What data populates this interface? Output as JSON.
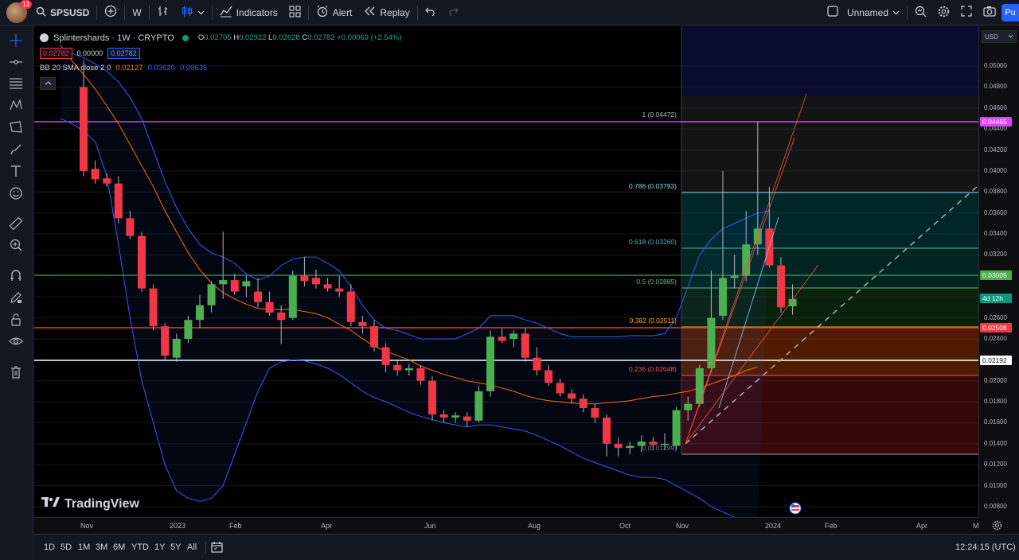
{
  "topbar": {
    "notifications": "13",
    "symbol": "SPSUSD",
    "interval": "W",
    "indicators": "Indicators",
    "alert": "Alert",
    "replay": "Replay",
    "layout_name": "Unnamed",
    "publish": "Pu"
  },
  "legend": {
    "title": "Splintershards · 1W · CRYPTO",
    "o_label": "O",
    "o": "0.02705",
    "h_label": "H",
    "h": "0.02922",
    "l_label": "L",
    "l": "0.02628",
    "c_label": "C",
    "c": "0.02782",
    "change": "+0.00069 (+2.54%)",
    "bid": "0.02782",
    "spread": "0.00000",
    "ask": "0.02782",
    "bb_name": "BB 20 SMA close 2 0",
    "bb_basis": "0.02127",
    "bb_upper": "0.03620",
    "bb_lower": "0.00635"
  },
  "fib": {
    "l1": "1 (0.04472)",
    "l0786": "0.786 (0.03793)",
    "l0618": "0.618 (0.03260)",
    "l05": "0.5 (0.02885)",
    "l0382": "0.382 (0.02511)",
    "l0236": "0.236 (0.02048)",
    "l0": "0 (0.01299)"
  },
  "price_axis": {
    "currency": "USD",
    "ticks": [
      "0.05000",
      "0.04800",
      "0.04600",
      "0.04400",
      "0.04200",
      "0.04000",
      "0.03800",
      "0.03600",
      "0.03400",
      "0.03200",
      "0.03000",
      "0.02800",
      "0.02600",
      "0.02400",
      "0.02200",
      "0.02000",
      "0.01800",
      "0.01600",
      "0.01400",
      "0.01200",
      "0.01000",
      "0.00800"
    ],
    "tag_magenta": "0.04465",
    "tag_green": "0.03005",
    "tag_countdown": "4d 12h",
    "tag_red": "0.02508",
    "tag_white": "0.02192",
    "colors": {
      "magenta": "#e040fb",
      "green": "#4caf50",
      "red": "#f23645",
      "white": "#ffffff",
      "countdown": "#089981"
    }
  },
  "time_axis": {
    "labels": [
      "Nov",
      "2023",
      "Feb",
      "Apr",
      "Jun",
      "Aug",
      "Oct",
      "Nov",
      "2024",
      "Feb",
      "Apr",
      "M"
    ]
  },
  "bottombar": {
    "ranges": [
      "1D",
      "5D",
      "1M",
      "3M",
      "6M",
      "YTD",
      "1Y",
      "5Y",
      "All"
    ],
    "clock": "12:24:15 (UTC)"
  },
  "watermark": "TradingView",
  "chart_data": {
    "type": "candlestick",
    "symbol": "SPSUSD",
    "interval": "1W",
    "ylim": [
      0.007,
      0.0515
    ],
    "colors": {
      "up": "#26a69a",
      "down": "#f23645",
      "bb_band": "#2962ff",
      "bb_basis": "#ff6d00"
    },
    "candles": [
      {
        "o": 0.048,
        "h": 0.0505,
        "l": 0.0395,
        "c": 0.04
      },
      {
        "o": 0.0402,
        "h": 0.041,
        "l": 0.0388,
        "c": 0.0392
      },
      {
        "o": 0.0393,
        "h": 0.0398,
        "l": 0.0385,
        "c": 0.0388
      },
      {
        "o": 0.0388,
        "h": 0.0395,
        "l": 0.035,
        "c": 0.0355
      },
      {
        "o": 0.0355,
        "h": 0.0362,
        "l": 0.0335,
        "c": 0.0338
      },
      {
        "o": 0.0338,
        "h": 0.0342,
        "l": 0.0285,
        "c": 0.0288
      },
      {
        "o": 0.0288,
        "h": 0.0292,
        "l": 0.0248,
        "c": 0.0252
      },
      {
        "o": 0.0252,
        "h": 0.0255,
        "l": 0.022,
        "c": 0.0224
      },
      {
        "o": 0.0222,
        "h": 0.0245,
        "l": 0.0218,
        "c": 0.024
      },
      {
        "o": 0.024,
        "h": 0.0262,
        "l": 0.0236,
        "c": 0.0258
      },
      {
        "o": 0.0258,
        "h": 0.0282,
        "l": 0.025,
        "c": 0.0272
      },
      {
        "o": 0.0272,
        "h": 0.0295,
        "l": 0.0265,
        "c": 0.0292
      },
      {
        "o": 0.0292,
        "h": 0.0342,
        "l": 0.0278,
        "c": 0.0296
      },
      {
        "o": 0.0296,
        "h": 0.0302,
        "l": 0.0282,
        "c": 0.0285
      },
      {
        "o": 0.029,
        "h": 0.03,
        "l": 0.028,
        "c": 0.0295
      },
      {
        "o": 0.0285,
        "h": 0.0298,
        "l": 0.027,
        "c": 0.0275
      },
      {
        "o": 0.0275,
        "h": 0.0285,
        "l": 0.0262,
        "c": 0.0265
      },
      {
        "o": 0.0265,
        "h": 0.0272,
        "l": 0.0235,
        "c": 0.0258
      },
      {
        "o": 0.026,
        "h": 0.0305,
        "l": 0.0258,
        "c": 0.03
      },
      {
        "o": 0.03,
        "h": 0.0318,
        "l": 0.029,
        "c": 0.0295
      },
      {
        "o": 0.0298,
        "h": 0.0306,
        "l": 0.0288,
        "c": 0.0292
      },
      {
        "o": 0.0292,
        "h": 0.0298,
        "l": 0.0285,
        "c": 0.0288
      },
      {
        "o": 0.0288,
        "h": 0.03,
        "l": 0.028,
        "c": 0.0285
      },
      {
        "o": 0.0285,
        "h": 0.0292,
        "l": 0.0252,
        "c": 0.0256
      },
      {
        "o": 0.0256,
        "h": 0.0262,
        "l": 0.0245,
        "c": 0.0252
      },
      {
        "o": 0.0252,
        "h": 0.0258,
        "l": 0.0228,
        "c": 0.0232
      },
      {
        "o": 0.0232,
        "h": 0.0236,
        "l": 0.0208,
        "c": 0.0215
      },
      {
        "o": 0.0215,
        "h": 0.022,
        "l": 0.0205,
        "c": 0.021
      },
      {
        "o": 0.021,
        "h": 0.0216,
        "l": 0.0205,
        "c": 0.0212
      },
      {
        "o": 0.0212,
        "h": 0.0215,
        "l": 0.0196,
        "c": 0.02
      },
      {
        "o": 0.02,
        "h": 0.0204,
        "l": 0.0162,
        "c": 0.0168
      },
      {
        "o": 0.0168,
        "h": 0.0172,
        "l": 0.016,
        "c": 0.0165
      },
      {
        "o": 0.0165,
        "h": 0.017,
        "l": 0.016,
        "c": 0.0167
      },
      {
        "o": 0.0166,
        "h": 0.017,
        "l": 0.0156,
        "c": 0.0162
      },
      {
        "o": 0.0162,
        "h": 0.0195,
        "l": 0.016,
        "c": 0.019
      },
      {
        "o": 0.019,
        "h": 0.0248,
        "l": 0.0185,
        "c": 0.0242
      },
      {
        "o": 0.0242,
        "h": 0.025,
        "l": 0.0236,
        "c": 0.0238
      },
      {
        "o": 0.024,
        "h": 0.0248,
        "l": 0.0232,
        "c": 0.0245
      },
      {
        "o": 0.0245,
        "h": 0.025,
        "l": 0.0218,
        "c": 0.0222
      },
      {
        "o": 0.0222,
        "h": 0.0232,
        "l": 0.0205,
        "c": 0.021
      },
      {
        "o": 0.021,
        "h": 0.0215,
        "l": 0.0195,
        "c": 0.0198
      },
      {
        "o": 0.0198,
        "h": 0.0202,
        "l": 0.0185,
        "c": 0.0188
      },
      {
        "o": 0.0188,
        "h": 0.0192,
        "l": 0.0178,
        "c": 0.0183
      },
      {
        "o": 0.0183,
        "h": 0.0187,
        "l": 0.017,
        "c": 0.0174
      },
      {
        "o": 0.0174,
        "h": 0.0178,
        "l": 0.016,
        "c": 0.0165
      },
      {
        "o": 0.0165,
        "h": 0.0168,
        "l": 0.0128,
        "c": 0.014
      },
      {
        "o": 0.014,
        "h": 0.0145,
        "l": 0.0128,
        "c": 0.0136
      },
      {
        "o": 0.0136,
        "h": 0.0142,
        "l": 0.013,
        "c": 0.0138
      },
      {
        "o": 0.0138,
        "h": 0.0148,
        "l": 0.0132,
        "c": 0.0142
      },
      {
        "o": 0.0142,
        "h": 0.0146,
        "l": 0.0134,
        "c": 0.0139
      },
      {
        "o": 0.0139,
        "h": 0.015,
        "l": 0.0134,
        "c": 0.014
      },
      {
        "o": 0.0138,
        "h": 0.0175,
        "l": 0.0134,
        "c": 0.0172
      },
      {
        "o": 0.0172,
        "h": 0.0185,
        "l": 0.0162,
        "c": 0.0178
      },
      {
        "o": 0.0178,
        "h": 0.0215,
        "l": 0.0175,
        "c": 0.0212
      },
      {
        "o": 0.0212,
        "h": 0.0305,
        "l": 0.0208,
        "c": 0.026
      },
      {
        "o": 0.0262,
        "h": 0.04,
        "l": 0.0258,
        "c": 0.0298
      },
      {
        "o": 0.0298,
        "h": 0.032,
        "l": 0.0288,
        "c": 0.03
      },
      {
        "o": 0.03,
        "h": 0.0362,
        "l": 0.0295,
        "c": 0.033
      },
      {
        "o": 0.033,
        "h": 0.0447,
        "l": 0.032,
        "c": 0.0345
      },
      {
        "o": 0.0345,
        "h": 0.0385,
        "l": 0.0308,
        "c": 0.031
      },
      {
        "o": 0.031,
        "h": 0.0318,
        "l": 0.0265,
        "c": 0.027
      },
      {
        "o": 0.0271,
        "h": 0.0292,
        "l": 0.0263,
        "c": 0.0278
      }
    ],
    "bb_upper": [
      0.051,
      0.0512,
      0.0508,
      0.0502,
      0.0495,
      0.0485,
      0.047,
      0.045,
      0.042,
      0.039,
      0.0365,
      0.0345,
      0.033,
      0.0322,
      0.0318,
      0.0312,
      0.0302,
      0.0296,
      0.03,
      0.031,
      0.0316,
      0.0318,
      0.0318,
      0.0312,
      0.0305,
      0.029,
      0.0272,
      0.0258,
      0.025,
      0.0248,
      0.0244,
      0.024,
      0.024,
      0.024,
      0.024,
      0.0245,
      0.025,
      0.0262,
      0.0262,
      0.0262,
      0.0258,
      0.0255,
      0.025,
      0.0245,
      0.0242,
      0.0242,
      0.0242,
      0.0242,
      0.0242,
      0.0243,
      0.0243,
      0.0243,
      0.0245,
      0.026,
      0.029,
      0.032,
      0.0335,
      0.0345,
      0.035,
      0.0355,
      0.036,
      0.0362
    ],
    "bb_basis": [
      0.052,
      0.0505,
      0.0492,
      0.0478,
      0.0462,
      0.0445,
      0.0425,
      0.0405,
      0.0385,
      0.0362,
      0.0342,
      0.0322,
      0.0306,
      0.0293,
      0.0284,
      0.0278,
      0.0273,
      0.0269,
      0.0268,
      0.0268,
      0.0268,
      0.0266,
      0.0264,
      0.026,
      0.0254,
      0.0248,
      0.024,
      0.0233,
      0.0228,
      0.0224,
      0.022,
      0.0214,
      0.021,
      0.0206,
      0.0203,
      0.02,
      0.0198,
      0.0196,
      0.0193,
      0.019,
      0.0186,
      0.0183,
      0.0181,
      0.018,
      0.0179,
      0.0178,
      0.0178,
      0.0179,
      0.018,
      0.0181,
      0.0183,
      0.0185,
      0.0186,
      0.0188,
      0.019,
      0.0193,
      0.0197,
      0.0201,
      0.0205,
      0.021,
      0.0213
    ],
    "bb_lower": [
      0.045,
      0.0445,
      0.0438,
      0.0428,
      0.0395,
      0.033,
      0.026,
      0.02,
      0.016,
      0.012,
      0.0095,
      0.0088,
      0.0085,
      0.0088,
      0.01,
      0.013,
      0.016,
      0.019,
      0.0212,
      0.0218,
      0.022,
      0.0219,
      0.0216,
      0.0212,
      0.0206,
      0.0198,
      0.019,
      0.0184,
      0.018,
      0.0175,
      0.017,
      0.0166,
      0.0163,
      0.016,
      0.0158,
      0.0156,
      0.0158,
      0.0158,
      0.0156,
      0.0154,
      0.0152,
      0.0148,
      0.0143,
      0.0138,
      0.0132,
      0.0126,
      0.0122,
      0.0118,
      0.0114,
      0.011,
      0.0108,
      0.0108,
      0.0106,
      0.01,
      0.0094,
      0.0088,
      0.008,
      0.0075,
      0.007,
      0.0066,
      0.0064
    ]
  }
}
